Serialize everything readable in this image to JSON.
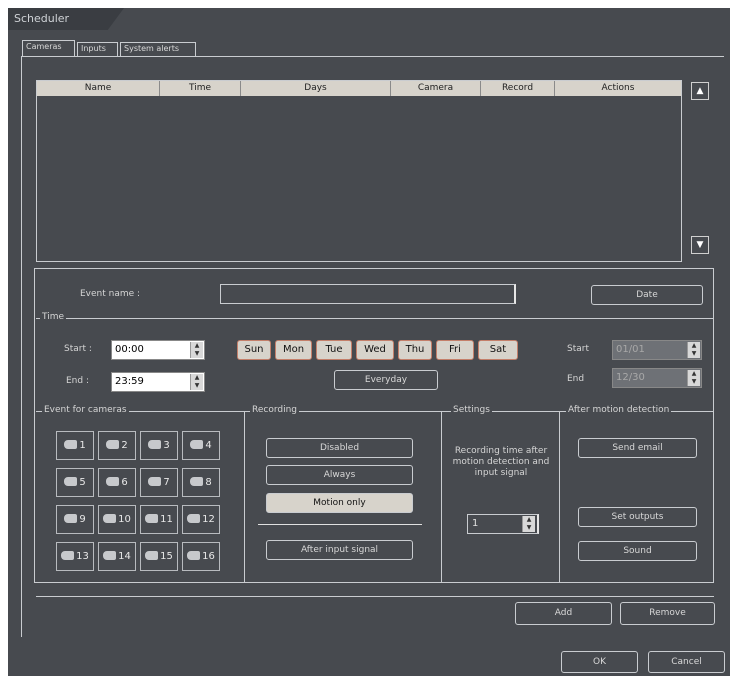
{
  "window": {
    "title": "Scheduler"
  },
  "tabs": [
    {
      "label": "Cameras"
    },
    {
      "label": "Inputs"
    },
    {
      "label": "System alerts"
    }
  ],
  "grid": {
    "columns": [
      "Name",
      "Time",
      "Days",
      "Camera",
      "Record",
      "Actions"
    ],
    "scroll_up": "▲",
    "scroll_down": "▼"
  },
  "event": {
    "name_label": "Event name :",
    "name_value": "",
    "date_button": "Date"
  },
  "time": {
    "section": "Time",
    "start_label": "Start :",
    "start_value": "00:00",
    "end_label": "End :",
    "end_value": "23:59",
    "days": [
      "Sun",
      "Mon",
      "Tue",
      "Wed",
      "Thu",
      "Fri",
      "Sat"
    ],
    "everyday_button": "Everyday",
    "date_start_label": "Start",
    "date_start_value": "01/01",
    "date_end_label": "End",
    "date_end_value": "12/30"
  },
  "cameras": {
    "section": "Event for cameras",
    "items": [
      "1",
      "2",
      "3",
      "4",
      "5",
      "6",
      "7",
      "8",
      "9",
      "10",
      "11",
      "12",
      "13",
      "14",
      "15",
      "16"
    ]
  },
  "recording": {
    "section": "Recording",
    "disabled": "Disabled",
    "always": "Always",
    "motion_only": "Motion only",
    "after_input": "After input signal"
  },
  "settings": {
    "section": "Settings",
    "text": "Recording time after motion detection and input signal",
    "value": "1"
  },
  "after_motion": {
    "section": "After motion detection",
    "send_email": "Send email",
    "set_outputs": "Set outputs",
    "sound": "Sound"
  },
  "actions": {
    "add": "Add",
    "remove": "Remove"
  },
  "footer": {
    "ok": "OK",
    "cancel": "Cancel"
  }
}
